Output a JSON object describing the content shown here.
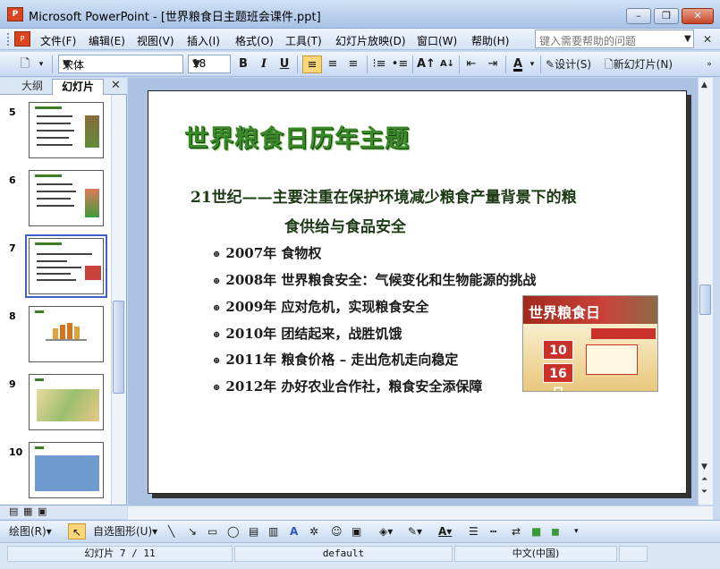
{
  "app": {
    "icon_text": "P",
    "title": "Microsoft PowerPoint - [世界粮食日主题班会课件.ppt]"
  },
  "window_buttons": {
    "minimize": "–",
    "restore": "❐",
    "close": "✕"
  },
  "menu": {
    "items": [
      "文件(F)",
      "编辑(E)",
      "视图(V)",
      "插入(I)",
      "格式(O)",
      "工具(T)",
      "幻灯片放映(D)",
      "窗口(W)",
      "帮助(H)"
    ],
    "help_placeholder": "键入需要帮助的问题",
    "doc_close": "✕"
  },
  "toolbar": {
    "font": "宋体",
    "size": "18",
    "bold": "B",
    "italic": "I",
    "underline": "U",
    "design": "设计(S)",
    "new_slide": "新幻灯片(N)"
  },
  "left_pane": {
    "tabs": [
      "大纲",
      "幻灯片"
    ],
    "close": "✕",
    "slide_numbers": [
      "5",
      "6",
      "7",
      "8",
      "9",
      "10"
    ],
    "selected": "7"
  },
  "slide": {
    "title": "世界粮食日历年主题",
    "lead_line1": "21世纪——主要注重在保护环境减少粮食产量背景下的粮",
    "lead_line2": "食供给与食品安全",
    "bullets": [
      {
        "year": "2007年",
        "text": "食物权"
      },
      {
        "year": "2008年",
        "text": "世界粮食安全：气候变化和生物能源的挑战"
      },
      {
        "year": "2009年",
        "text": "应对危机，实现粮食安全"
      },
      {
        "year": "2010年",
        "text": "团结起来，战胜饥饿"
      },
      {
        "year": "2011年",
        "text": "粮食价格 – 走出危机走向稳定"
      },
      {
        "year": "2012年",
        "text": "办好农业合作社，粮食安全添保障"
      }
    ],
    "poster": {
      "title": "世界粮食日",
      "month": "10月",
      "day": "16日"
    }
  },
  "drawing_bar": {
    "draw": "绘图(R)",
    "autoshapes": "自选图形(U)"
  },
  "status": {
    "slide_info": "幻灯片 7 / 11",
    "template": "default",
    "language": "中文(中国)"
  },
  "colors": {
    "title_green": "#3b8a2a",
    "accent_blue": "#3d63c2"
  }
}
